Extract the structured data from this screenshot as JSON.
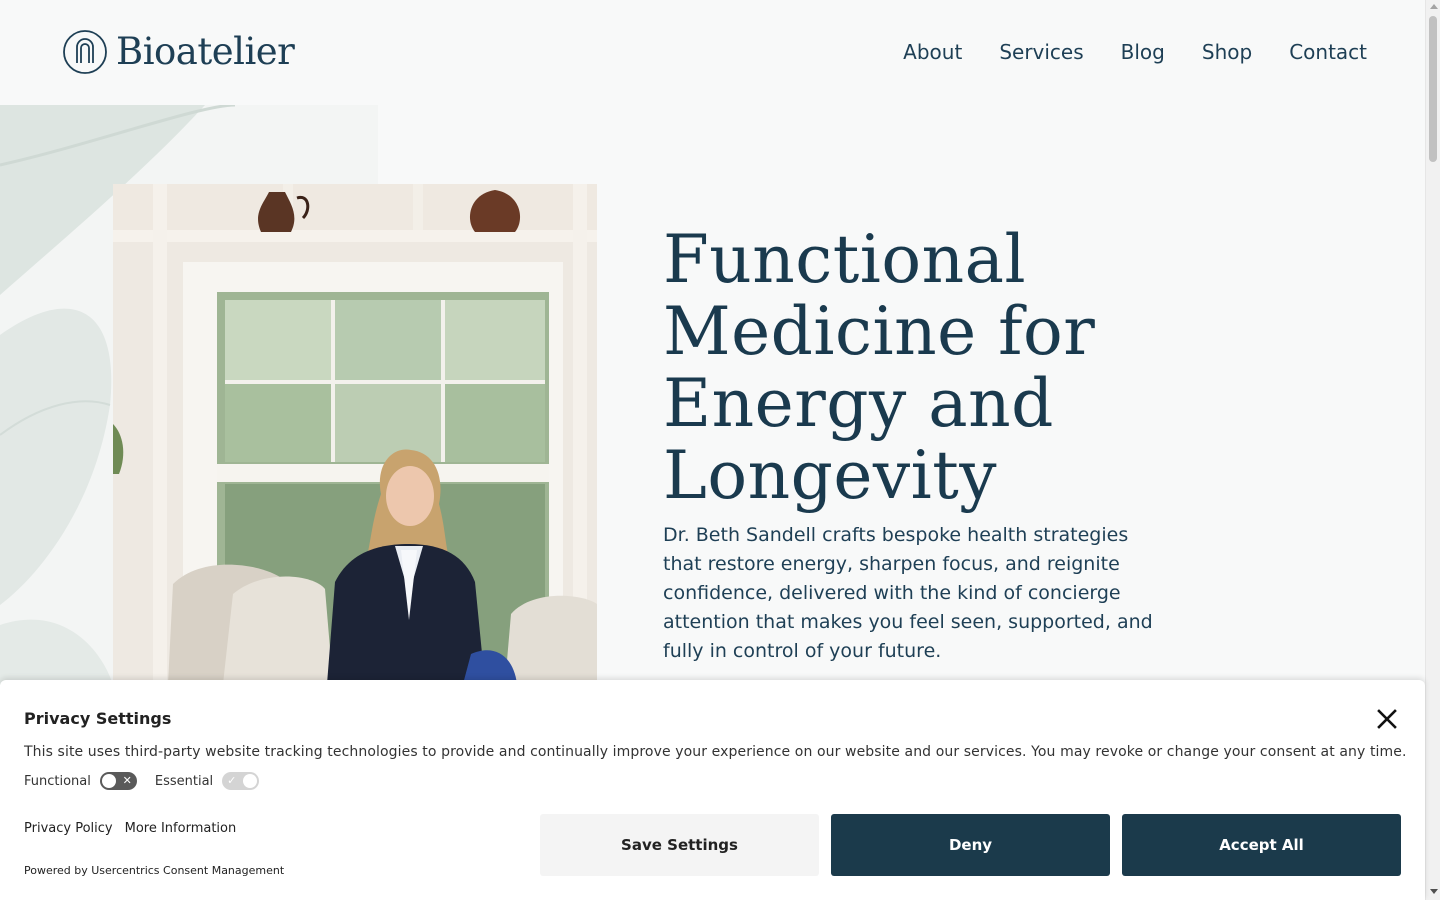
{
  "header": {
    "logo_text": "Bioatelier",
    "nav": [
      {
        "label": "About"
      },
      {
        "label": "Services"
      },
      {
        "label": "Blog"
      },
      {
        "label": "Shop"
      },
      {
        "label": "Contact"
      }
    ]
  },
  "hero": {
    "title_lines": [
      "Functional",
      "Medicine for",
      "Energy and",
      "Longevity"
    ],
    "description": "Dr. Beth Sandell crafts bespoke health strategies that restore energy, sharpen focus, and reignite confidence, delivered with the kind of concierge attention that makes you feel seen, supported, and fully in control of your future."
  },
  "consent": {
    "title": "Privacy Settings",
    "description": "This site uses third-party website tracking technologies to provide and continually improve your experience on our website and our services. You may revoke or change your consent at any time.",
    "toggles": [
      {
        "label": "Functional",
        "state": "off"
      },
      {
        "label": "Essential",
        "state": "on"
      }
    ],
    "links": [
      "Privacy Policy",
      "More Information"
    ],
    "powered_by": "Powered by Usercentrics Consent Management",
    "buttons": {
      "save": "Save Settings",
      "deny": "Deny",
      "accept": "Accept All"
    }
  },
  "colors": {
    "brand_navy": "#1b3a4b",
    "page_bg": "#f8f9f9"
  }
}
